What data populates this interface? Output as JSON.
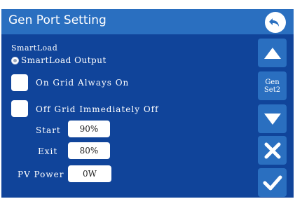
{
  "header": {
    "title": "Gen Port Setting"
  },
  "smartload": {
    "title": "SmartLoad",
    "radio_label": "SmartLoad Output",
    "on_grid_label": "On Grid Always On",
    "off_grid_label": "Off Grid Immediately Off",
    "start_label": "Start",
    "start_value": "90%",
    "exit_label": "Exit",
    "exit_value": "80%",
    "pv_power_label": "PV Power",
    "pv_power_value": "0W"
  },
  "sidebar": {
    "gen_set_line1": "Gen",
    "gen_set_line2": "Set2"
  },
  "colors": {
    "header": "#2a6fc0",
    "panel": "#10449a",
    "button": "#2a6fc0"
  }
}
